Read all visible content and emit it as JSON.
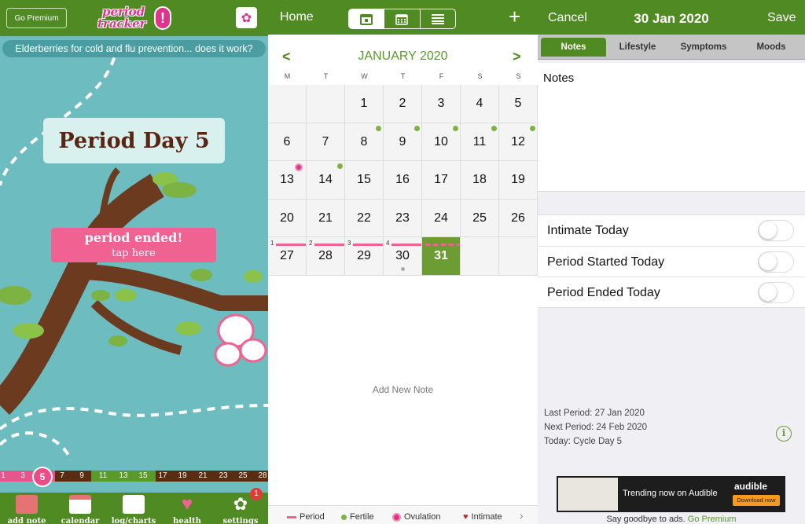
{
  "left": {
    "go_premium": "Go Premium",
    "logo_line1": "period",
    "logo_line2": "tracker",
    "logo_bang": "!",
    "news": "Elderberries for cold and flu prevention... does it work?",
    "day_label": "Period Day 5",
    "ended_title": "period ended!",
    "ended_sub": "tap here",
    "cycle_days": [
      "1",
      "3",
      "5",
      "7",
      "9",
      "11",
      "13",
      "15",
      "17",
      "19",
      "21",
      "23",
      "25",
      "28"
    ],
    "cycle_today": "5",
    "nav": [
      {
        "label": "add note",
        "icon": "note-icon"
      },
      {
        "label": "calendar",
        "icon": "calendar-icon"
      },
      {
        "label": "log/charts",
        "icon": "chart-icon"
      },
      {
        "label": "health",
        "icon": "heart-icon"
      },
      {
        "label": "settings",
        "icon": "gear-icon"
      }
    ],
    "settings_badge": "1",
    "colors": {
      "bar": "#4f8a22",
      "sky": "#6cbcc0",
      "pink": "#f06292"
    }
  },
  "middle": {
    "home": "Home",
    "month": "JANUARY 2020",
    "prev": "<",
    "next": ">",
    "plus": "+",
    "weekdays": [
      "M",
      "T",
      "W",
      "T",
      "F",
      "S",
      "S"
    ],
    "days": [
      "",
      "",
      "1",
      "2",
      "3",
      "4",
      "5",
      "6",
      "7",
      "8",
      "9",
      "10",
      "11",
      "12",
      "13",
      "14",
      "15",
      "16",
      "17",
      "18",
      "19",
      "20",
      "21",
      "22",
      "23",
      "24",
      "25",
      "26",
      "27",
      "28",
      "29",
      "30",
      "31",
      "",
      ""
    ],
    "today": "31",
    "period_counts": [
      "1",
      "2",
      "3",
      "4"
    ],
    "add_note": "Add New Note",
    "legend": [
      {
        "label": "Period",
        "icon": "period-line-icon"
      },
      {
        "label": "Fertile",
        "icon": "fertile-dot-icon"
      },
      {
        "label": "Ovulation",
        "icon": "flower-icon"
      },
      {
        "label": "Intimate",
        "icon": "heart-icon"
      }
    ]
  },
  "right": {
    "cancel": "Cancel",
    "date": "30 Jan 2020",
    "save": "Save",
    "tabs": [
      "Notes",
      "Lifestyle",
      "Symptoms",
      "Moods"
    ],
    "active_tab": "Notes",
    "notes_label": "Notes",
    "toggles": [
      "Intimate Today",
      "Period Started Today",
      "Period Ended Today"
    ],
    "last_period": "Last Period: 27 Jan 2020",
    "next_period": "Next Period: 24 Feb 2020",
    "today_cycle": "Today: Cycle Day 5",
    "ad_text": "Trending now on Audible",
    "ad_brand": "audible",
    "ad_cta": "Download now",
    "ads_note": "Say goodbye to ads.",
    "ads_go_premium": "Go Premium"
  }
}
